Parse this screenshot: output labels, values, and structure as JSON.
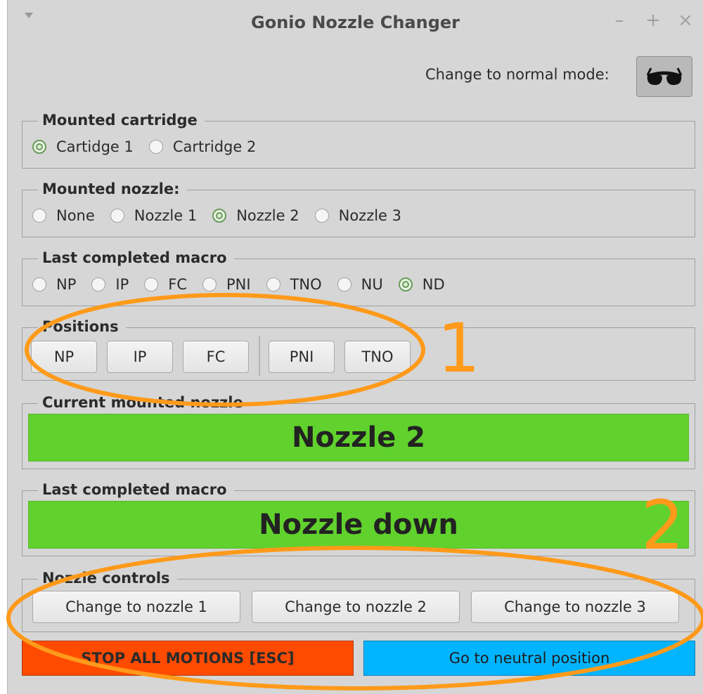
{
  "window": {
    "title": "Gonio Nozzle Changer",
    "minimize": "–",
    "maximize": "+",
    "close": "×"
  },
  "mode": {
    "label": "Change to normal mode:",
    "icon": "sunglasses-icon"
  },
  "mounted_cartridge": {
    "title": "Mounted cartridge",
    "options": [
      "Cartidge 1",
      "Cartridge 2"
    ],
    "selected": "Cartidge 1"
  },
  "mounted_nozzle": {
    "title": "Mounted nozzle:",
    "options": [
      "None",
      "Nozzle 1",
      "Nozzle 2",
      "Nozzle 3"
    ],
    "selected": "Nozzle 2"
  },
  "last_macro_radios": {
    "title": "Last completed macro",
    "options": [
      "NP",
      "IP",
      "FC",
      "PNI",
      "TNO",
      "NU",
      "ND"
    ],
    "selected": "ND"
  },
  "positions": {
    "title": "Positions",
    "buttons": [
      "NP",
      "IP",
      "FC",
      "PNI",
      "TNO"
    ]
  },
  "current_nozzle": {
    "title": "Current mounted nozzle",
    "value": "Nozzle 2",
    "color": "#61d12d"
  },
  "last_macro_display": {
    "title": "Last completed macro",
    "value": "Nozzle down",
    "color": "#61d12d"
  },
  "nozzle_controls": {
    "title": "Nozzle controls",
    "buttons": [
      "Change to nozzle 1",
      "Change to nozzle 2",
      "Change to nozzle 3"
    ]
  },
  "actions": {
    "stop": "STOP ALL MOTIONS [ESC]",
    "stop_color": "#ff4b00",
    "neutral": "Go to neutral position",
    "neutral_color": "#00b4ff"
  },
  "annotations": {
    "one": "1",
    "two": "2",
    "color": "#ff9a1a"
  }
}
